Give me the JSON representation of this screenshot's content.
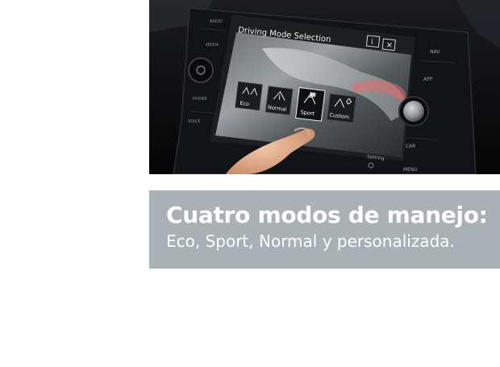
{
  "photo": {
    "screen_title": "Driving Mode Selection",
    "side_buttons_left": [
      "RADIO",
      "MEDIA",
      "PHONE",
      "VOICE"
    ],
    "side_buttons_right": [
      "NAV",
      "APP",
      "CAR",
      "MENU"
    ],
    "modes": [
      {
        "label": "Eco",
        "selected": false
      },
      {
        "label": "Normal",
        "selected": false
      },
      {
        "label": "Sport",
        "selected": true
      },
      {
        "label": "Custom",
        "selected": false
      }
    ],
    "bottom_items": [
      "Setting"
    ],
    "colors": {
      "bezel": "#101114",
      "screen": "#2b2e31",
      "mode_tile": "#1a1c1f",
      "mode_tile_selected": "#0f1012"
    }
  },
  "caption": {
    "title": "Cuatro modos de manejo:",
    "subtitle": "Eco, Sport, Normal y personalizada.",
    "background": "#a9b1b4",
    "text_color": "#ffffff"
  }
}
